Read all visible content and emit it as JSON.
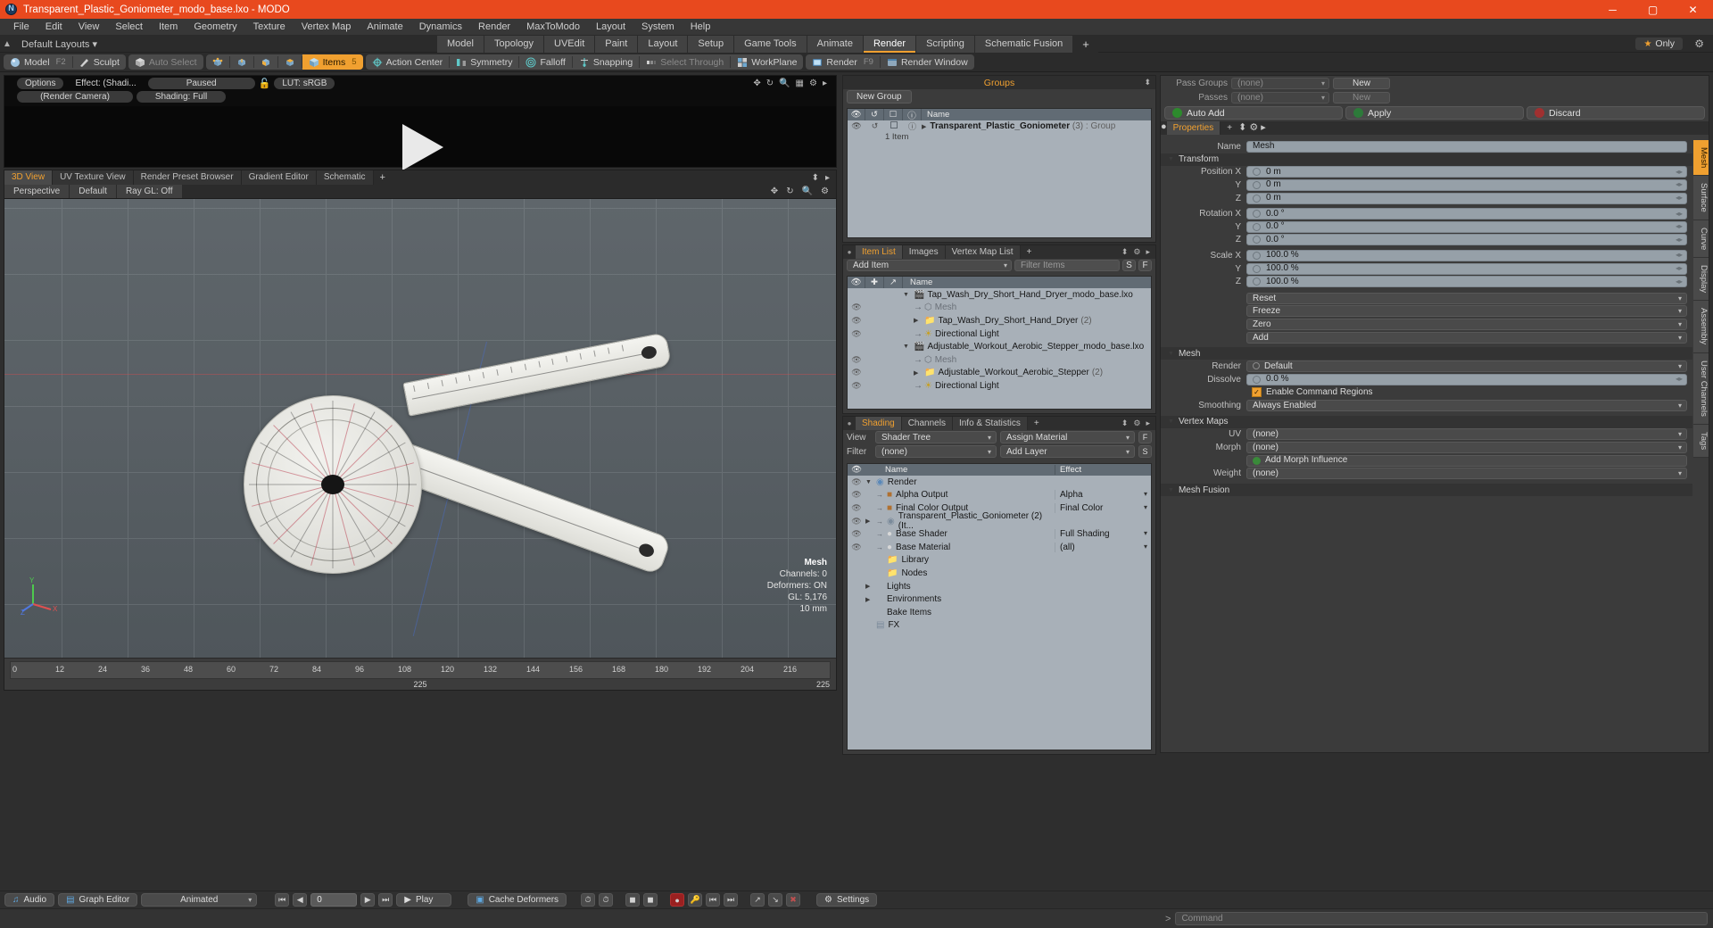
{
  "window": {
    "title": "Transparent_Plastic_Goniometer_modo_base.lxo - MODO",
    "minimize": "─",
    "maximize": "▢",
    "close": "✕"
  },
  "menu": [
    "File",
    "Edit",
    "View",
    "Select",
    "Item",
    "Geometry",
    "Texture",
    "Vertex Map",
    "Animate",
    "Dynamics",
    "Render",
    "MaxToModo",
    "Layout",
    "System",
    "Help"
  ],
  "layout_row": {
    "home_icon": "home-icon",
    "default_layouts": "Default Layouts ▾",
    "tabs": [
      {
        "label": "Model",
        "active": false
      },
      {
        "label": "Topology",
        "active": false
      },
      {
        "label": "UVEdit",
        "active": false
      },
      {
        "label": "Paint",
        "active": false
      },
      {
        "label": "Layout",
        "active": false
      },
      {
        "label": "Setup",
        "active": false
      },
      {
        "label": "Game Tools",
        "active": false
      },
      {
        "label": "Animate",
        "active": false
      },
      {
        "label": "Render",
        "active": true
      },
      {
        "label": "Scripting",
        "active": false
      },
      {
        "label": "Schematic Fusion",
        "active": false
      }
    ],
    "add_tab": "+",
    "only_label": "Only",
    "star_icon": "star-icon",
    "gear_icon": "gear-icon"
  },
  "toolbar": {
    "model": {
      "label": "Model",
      "hotkey": "F2"
    },
    "sculpt": {
      "label": "Sculpt"
    },
    "auto_select": {
      "label": "Auto Select"
    },
    "component_modes": [
      "vertices-icon",
      "edges-icon",
      "polygons-icon",
      "materials-icon"
    ],
    "items": {
      "label": "Items",
      "hotkey": "5"
    },
    "action_center": {
      "label": "Action Center"
    },
    "symmetry": {
      "label": "Symmetry"
    },
    "falloff": {
      "label": "Falloff"
    },
    "snapping": {
      "label": "Snapping"
    },
    "select_through": {
      "label": "Select Through"
    },
    "workplane": {
      "label": "WorkPlane"
    },
    "render": {
      "label": "Render",
      "hotkey": "F9"
    },
    "render_window": {
      "label": "Render Window"
    }
  },
  "render_preview": {
    "options": "Options",
    "effect": "Effect: (Shadi...",
    "status": "Paused",
    "lock_icon": "unlocked-icon",
    "lut": "LUT: sRGB",
    "camera": "(Render Camera)",
    "shading": "Shading: Full",
    "play_icon": "play-triangle-icon"
  },
  "viewport": {
    "tabs": [
      {
        "label": "3D View",
        "active": true
      },
      {
        "label": "UV Texture View",
        "active": false
      },
      {
        "label": "Render Preset Browser",
        "active": false
      },
      {
        "label": "Gradient Editor",
        "active": false
      },
      {
        "label": "Schematic",
        "active": false
      }
    ],
    "add_tab": "+",
    "controls": [
      "Perspective",
      "Default",
      "Ray GL: Off"
    ],
    "info": {
      "title": "Mesh",
      "channels": "Channels: 0",
      "deformers": "Deformers: ON",
      "gl": "GL: 5,176",
      "scale": "10 mm"
    },
    "timeline": {
      "ticks": [
        "0",
        "12",
        "24",
        "36",
        "48",
        "60",
        "72",
        "84",
        "96",
        "108",
        "120",
        "132",
        "144",
        "156",
        "168",
        "180",
        "192",
        "204",
        "216"
      ],
      "mid": "225",
      "end": "225"
    }
  },
  "groups_panel": {
    "title": "Groups",
    "new_group": "New Group",
    "columns": [
      "Name"
    ],
    "item": {
      "name": "Transparent_Plastic_Goniometer",
      "count": "(3)",
      "type": ": Group",
      "sub": "1 Item"
    }
  },
  "item_list_panel": {
    "tabs": [
      {
        "label": "Item List",
        "active": true
      },
      {
        "label": "Images",
        "active": false
      },
      {
        "label": "Vertex Map List",
        "active": false
      }
    ],
    "add_tab": "+",
    "add_item": "Add Item",
    "filter_placeholder": "Filter Items",
    "btn_s": "S",
    "btn_f": "F",
    "column_name": "Name",
    "rows": [
      {
        "name": "Tap_Wash_Dry_Short_Hand_Dryer_modo_base.lxo",
        "count": "",
        "indent": 0,
        "kind": "scene",
        "expanded": true
      },
      {
        "name": "Mesh",
        "count": "",
        "indent": 1,
        "kind": "mesh",
        "expanded": false
      },
      {
        "name": "Tap_Wash_Dry_Short_Hand_Dryer",
        "count": "(2)",
        "indent": 1,
        "kind": "group",
        "expanded": false
      },
      {
        "name": "Directional Light",
        "count": "",
        "indent": 1,
        "kind": "light",
        "expanded": false
      },
      {
        "name": "Adjustable_Workout_Aerobic_Stepper_modo_base.lxo",
        "count": "",
        "indent": 0,
        "kind": "scene",
        "expanded": true
      },
      {
        "name": "Mesh",
        "count": "",
        "indent": 1,
        "kind": "mesh",
        "expanded": false
      },
      {
        "name": "Adjustable_Workout_Aerobic_Stepper",
        "count": "(2)",
        "indent": 1,
        "kind": "group",
        "expanded": false
      },
      {
        "name": "Directional Light",
        "count": "",
        "indent": 1,
        "kind": "light",
        "expanded": false
      }
    ]
  },
  "shading_panel": {
    "tabs": [
      {
        "label": "Shading",
        "active": true
      },
      {
        "label": "Channels",
        "active": false
      },
      {
        "label": "Info & Statistics",
        "active": false
      }
    ],
    "add_tab": "+",
    "view_label": "View",
    "view_value": "Shader Tree",
    "assign_material": "Assign Material",
    "btn_f": "F",
    "filter_label": "Filter",
    "filter_value": "(none)",
    "add_layer": "Add Layer",
    "btn_s": "S",
    "col_name": "Name",
    "col_effect": "Effect",
    "rows": [
      {
        "name": "Render",
        "effect": "",
        "indent": 0,
        "icon": "render-icon",
        "expanded": true
      },
      {
        "name": "Alpha Output",
        "effect": "Alpha",
        "indent": 1,
        "icon": "output-icon"
      },
      {
        "name": "Final Color Output",
        "effect": "Final Color",
        "indent": 1,
        "icon": "output-icon"
      },
      {
        "name": "Transparent_Plastic_Goniometer (2) (It...",
        "effect": "",
        "indent": 1,
        "icon": "group-icon",
        "expanded": false
      },
      {
        "name": "Base Shader",
        "effect": "Full Shading",
        "indent": 1,
        "icon": "shader-icon"
      },
      {
        "name": "Base Material",
        "effect": "(all)",
        "indent": 1,
        "icon": "material-icon"
      },
      {
        "name": "Library",
        "effect": "",
        "indent": 1,
        "icon": "folder-icon"
      },
      {
        "name": "Nodes",
        "effect": "",
        "indent": 1,
        "icon": "folder-icon"
      },
      {
        "name": "Lights",
        "effect": "",
        "indent": 0,
        "icon": "none",
        "expanded": false
      },
      {
        "name": "Environments",
        "effect": "",
        "indent": 0,
        "icon": "none",
        "expanded": false
      },
      {
        "name": "Bake Items",
        "effect": "",
        "indent": 0,
        "icon": "none"
      },
      {
        "name": "FX",
        "effect": "",
        "indent": 0,
        "icon": "fx-icon"
      }
    ]
  },
  "properties_panel": {
    "pass_groups_label": "Pass Groups",
    "pass_groups_value": "(none)",
    "pass_groups_new": "New",
    "passes_label": "Passes",
    "passes_value": "(none)",
    "passes_new": "New",
    "auto_add": "Auto Add",
    "apply": "Apply",
    "discard": "Discard",
    "tabs": [
      {
        "label": "Properties",
        "active": true
      }
    ],
    "add_tab": "+",
    "expand_icon": "expand-icon",
    "gear_icon": "gear-icon",
    "arrow_icon": "chevron-right-icon",
    "name_label": "Name",
    "name_value": "Mesh",
    "sections": {
      "transform": "Transform",
      "mesh": "Mesh",
      "vertex_maps": "Vertex Maps",
      "mesh_fusion": "Mesh Fusion"
    },
    "transform_rows": [
      {
        "label": "Position X",
        "value": "0 m"
      },
      {
        "label": "Y",
        "value": "0 m"
      },
      {
        "label": "Z",
        "value": "0 m"
      },
      {
        "label": "Rotation X",
        "value": "0.0 °"
      },
      {
        "label": "Y",
        "value": "0.0 °"
      },
      {
        "label": "Z",
        "value": "0.0 °"
      },
      {
        "label": "Scale X",
        "value": "100.0 %"
      },
      {
        "label": "Y",
        "value": "100.0 %"
      },
      {
        "label": "Z",
        "value": "100.0 %"
      }
    ],
    "transform_buttons": [
      "Reset",
      "Freeze",
      "Zero",
      "Add"
    ],
    "mesh_rows": [
      {
        "label": "Render",
        "value": "Default",
        "kind": "dropdown"
      },
      {
        "label": "Dissolve",
        "value": "0.0 %",
        "kind": "value"
      },
      {
        "label": "",
        "value": "Enable Command Regions",
        "kind": "checkbox",
        "checked": true
      },
      {
        "label": "Smoothing",
        "value": "Always Enabled",
        "kind": "dropdown"
      }
    ],
    "vertex_map_rows": [
      {
        "label": "UV",
        "value": "(none)"
      },
      {
        "label": "Morph",
        "value": "(none)"
      },
      {
        "label": "",
        "value": "Add Morph Influence",
        "kind": "button"
      },
      {
        "label": "Weight",
        "value": "(none)"
      }
    ],
    "vertical_tabs": [
      {
        "label": "Mesh",
        "active": true
      },
      {
        "label": "Surface",
        "active": false
      },
      {
        "label": "Curve",
        "active": false
      },
      {
        "label": "Display",
        "active": false
      },
      {
        "label": "Assembly",
        "active": false
      },
      {
        "label": "User Channels",
        "active": false
      },
      {
        "label": "Tags",
        "active": false
      }
    ]
  },
  "statusbar": {
    "audio": "Audio",
    "graph_editor": "Graph Editor",
    "animated": "Animated",
    "frame_value": "0",
    "play": "Play",
    "cache_deformers": "Cache Deformers",
    "settings": "Settings",
    "transport": [
      "skip-start-icon",
      "step-back-icon",
      "step-forward-icon",
      "skip-end-icon"
    ],
    "record_icon": "record-icon",
    "keys": [
      "key-icon",
      "key-prev-icon",
      "key-next-icon"
    ]
  },
  "command_bar": {
    "prompt": ">",
    "placeholder": "Command"
  },
  "colors": {
    "accent": "#f0a030",
    "title_bar": "#e8491e",
    "panel_bg": "#3b3b3b",
    "list_bg": "#a8b0b8"
  }
}
